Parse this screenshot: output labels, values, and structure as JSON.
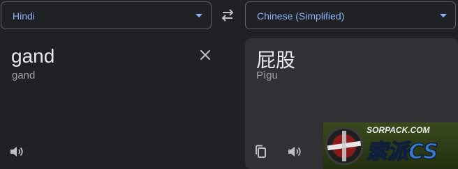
{
  "source": {
    "language": "Hindi",
    "text": "gand",
    "transliteration": "gand"
  },
  "target": {
    "language": "Chinese (Simplified)",
    "text": "屁股",
    "transliteration": "Pìgu"
  },
  "watermark": {
    "site": "SORPACK.COM",
    "brand": "索派CS"
  },
  "colors": {
    "background": "#202124",
    "target_panel": "#303134",
    "accent": "#8ab4f8",
    "text_primary": "#e8eaed",
    "text_secondary": "#9aa0a6",
    "icon": "#bdc1c6"
  },
  "icons": {
    "swap": "swap-horizontal-icon",
    "clear": "close-icon",
    "listen_source": "speaker-icon",
    "copy": "copy-icon",
    "listen_target": "speaker-icon"
  }
}
